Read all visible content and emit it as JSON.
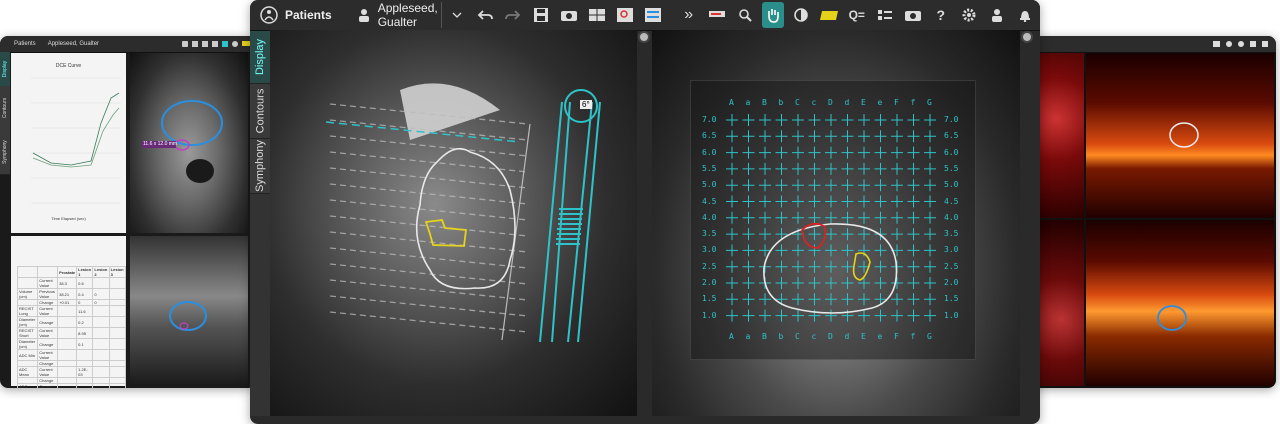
{
  "left_window": {
    "tabs": [
      "Patients",
      "Appleseed, Gualter"
    ],
    "side_tabs": [
      "Display",
      "Contours",
      "Symphony"
    ],
    "chart_title": "DCE Curve",
    "x_label": "Time Elapsed (sec)",
    "measure_label": "11.6 x 12.0 mm",
    "table_headers": [
      "",
      "",
      "Prostate",
      "Lesion 1",
      "Lesion 2",
      "Lesion 3"
    ],
    "table_rows": [
      [
        "",
        "Current Value",
        "38.3",
        "0.6",
        "",
        ""
      ],
      [
        "Volume (cm)",
        "Previous Value",
        "38.21",
        "0.4",
        "0",
        ""
      ],
      [
        "",
        "Change",
        "+0.01",
        "0",
        "0",
        ""
      ],
      [
        "RECIST Long",
        "Current Value",
        "",
        "11.6",
        "",
        ""
      ],
      [
        "Diameter (cm)",
        "Change",
        "",
        "0.2",
        "",
        ""
      ],
      [
        "RECIST Short",
        "Current Value",
        "",
        "8.95",
        "",
        ""
      ],
      [
        "Diameter (cm)",
        "Change",
        "",
        "0.1",
        "",
        ""
      ],
      [
        "ADC Min",
        "Current Value",
        "",
        "",
        "",
        ""
      ],
      [
        "",
        "Change",
        "",
        "",
        "",
        ""
      ],
      [
        "ADC Mean",
        "Current Value",
        "",
        "1.2E-03",
        "",
        ""
      ],
      [
        "",
        "Change",
        "",
        "",
        "",
        ""
      ],
      [
        "ADC Median",
        "Current Value",
        "",
        "",
        "",
        ""
      ],
      [
        "",
        "Change",
        "",
        "",
        "",
        ""
      ],
      [
        "ADC Max",
        "Current Value",
        "",
        "",
        "",
        ""
      ],
      [
        "",
        "Change",
        "",
        "",
        "",
        ""
      ]
    ]
  },
  "main_window": {
    "patients_label": "Patients",
    "patient_name": "Appleseed, Gualter",
    "side_tabs": [
      "Display",
      "Contours",
      "Symphony"
    ],
    "needle_angle": "6°",
    "grid_columns": [
      "A",
      "a",
      "B",
      "b",
      "C",
      "c",
      "D",
      "d",
      "E",
      "e",
      "F",
      "f",
      "G"
    ],
    "grid_rows": [
      "7.0",
      "6.5",
      "6.0",
      "5.5",
      "5.0",
      "4.5",
      "4.0",
      "3.5",
      "3.0",
      "2.5",
      "2.0",
      "1.5",
      "1.0"
    ],
    "toolbar_icons": [
      "undo-icon",
      "redo-icon",
      "save-icon",
      "camera-icon",
      "layout-icon",
      "zoom-region-icon",
      "sliders-icon",
      "more-icon",
      "ruler-icon",
      "magnify-icon",
      "pan-hand-icon",
      "contrast-icon",
      "eraser-icon",
      "query-icon",
      "layers-icon",
      "snapshot-icon",
      "help-icon",
      "gear-icon",
      "user-icon",
      "bell-icon"
    ],
    "help_glyph": "?",
    "query_glyph": "Q=",
    "more_glyph": "»"
  },
  "colors": {
    "accent": "#2ec3c8",
    "contour_white": "#e8e8e8",
    "lesion_yellow": "#e6d21a",
    "lesion_red": "#e02020",
    "prostate_blue": "#2a8fe0"
  }
}
